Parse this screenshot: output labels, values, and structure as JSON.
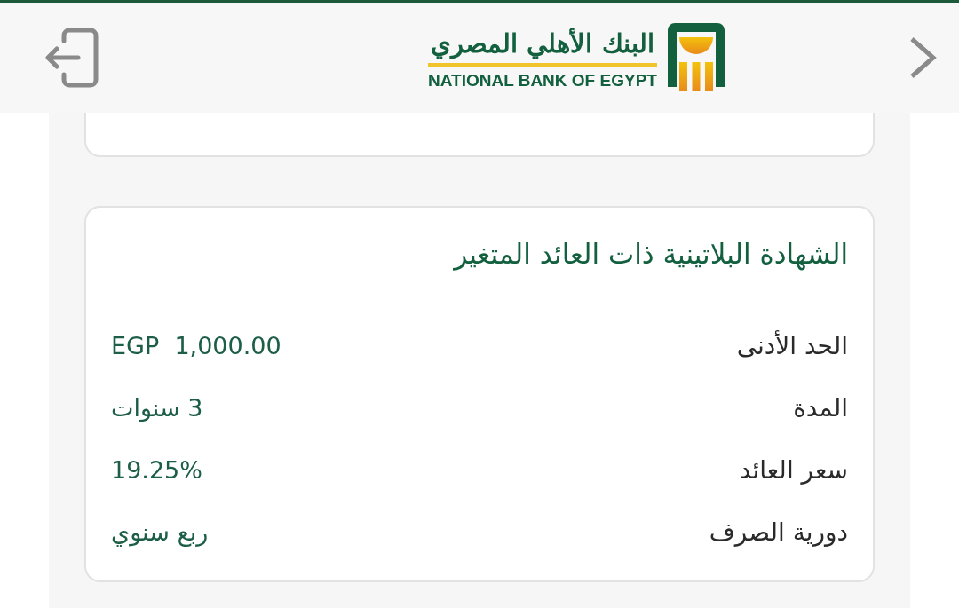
{
  "header": {
    "logo_arabic": "البنك الأهلي المصري",
    "logo_english": "NATIONAL BANK OF EGYPT"
  },
  "certificate": {
    "title": "الشهادة البلاتينية ذات العائد المتغير",
    "rows": [
      {
        "label": "الحد الأدنى",
        "value": "EGP  1,000.00"
      },
      {
        "label": "المدة",
        "value": "3 سنوات"
      },
      {
        "label": "سعر العائد",
        "value": "19.25%"
      },
      {
        "label": "دورية الصرف",
        "value": "ربع سنوي"
      }
    ]
  }
}
